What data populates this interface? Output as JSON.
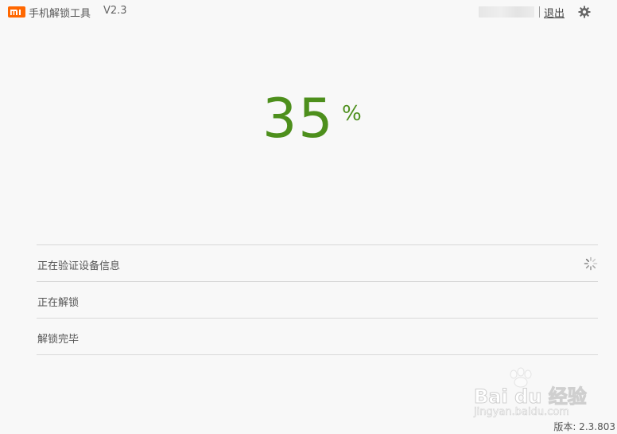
{
  "header": {
    "logo_icon": "mi-logo-icon",
    "title": "手机解锁工具",
    "version": "V2.3",
    "account_name": "",
    "logout_label": "退出",
    "settings_icon": "gear-icon"
  },
  "progress": {
    "value": "35",
    "unit": "%",
    "color": "#4d8f1c"
  },
  "steps": [
    {
      "label": "正在验证设备信息",
      "status": "in-progress"
    },
    {
      "label": "正在解锁",
      "status": "pending"
    },
    {
      "label": "解锁完毕",
      "status": "pending"
    }
  ],
  "watermark": {
    "brand": "Bai du 经验",
    "url": "jingyan.baidu.com"
  },
  "footer": {
    "version_text": "版本: 2.3.803"
  },
  "colors": {
    "brand_orange": "#ff6700",
    "accent_green": "#4d8f1c",
    "background": "#f8f8f8",
    "divider": "#d9d9d9"
  }
}
